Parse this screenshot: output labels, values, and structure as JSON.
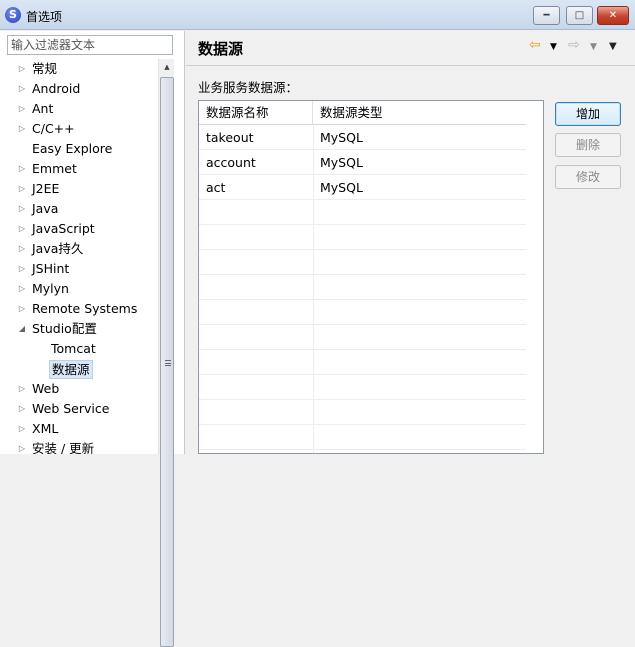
{
  "window": {
    "title": "首选项",
    "app_icon_glyph": "S",
    "minimize_glyph": "━",
    "maximize_glyph": "□",
    "close_glyph": "✕"
  },
  "filter": {
    "placeholder": "输入过滤器文本"
  },
  "tree": {
    "items": [
      {
        "label": "常规",
        "expandable": true
      },
      {
        "label": "Android",
        "expandable": true
      },
      {
        "label": "Ant",
        "expandable": true
      },
      {
        "label": "C/C++",
        "expandable": true
      },
      {
        "label": "Easy Explore",
        "expandable": false
      },
      {
        "label": "Emmet",
        "expandable": true
      },
      {
        "label": "J2EE",
        "expandable": true
      },
      {
        "label": "Java",
        "expandable": true
      },
      {
        "label": "JavaScript",
        "expandable": true
      },
      {
        "label": "Java持久",
        "expandable": true
      },
      {
        "label": "JSHint",
        "expandable": true
      },
      {
        "label": "Mylyn",
        "expandable": true
      },
      {
        "label": "Remote Systems",
        "expandable": true
      },
      {
        "label": "Studio配置",
        "expanded": true
      },
      {
        "label": "Tomcat",
        "child": true
      },
      {
        "label": "数据源",
        "child": true,
        "selected": true
      },
      {
        "label": "Web",
        "expandable": true
      },
      {
        "label": "Web Service",
        "expandable": true
      },
      {
        "label": "XML",
        "expandable": true
      },
      {
        "label": "安装 / 更新",
        "expandable": true
      }
    ]
  },
  "page": {
    "title": "数据源",
    "section_label": "业务服务数据源：",
    "nav": {
      "back": "⇦",
      "forward": "⇨",
      "dropdown": "▼"
    }
  },
  "table": {
    "columns": [
      "数据源名称",
      "数据源类型"
    ],
    "rows": [
      [
        "takeout",
        "MySQL"
      ],
      [
        "account",
        "MySQL"
      ],
      [
        "act",
        "MySQL"
      ]
    ]
  },
  "buttons": {
    "add": "增加",
    "delete": "删除",
    "edit": "修改"
  },
  "colors": {
    "accent": "#3c7fb1",
    "close": "#c4452f",
    "back_arrow": "#e8a317"
  }
}
